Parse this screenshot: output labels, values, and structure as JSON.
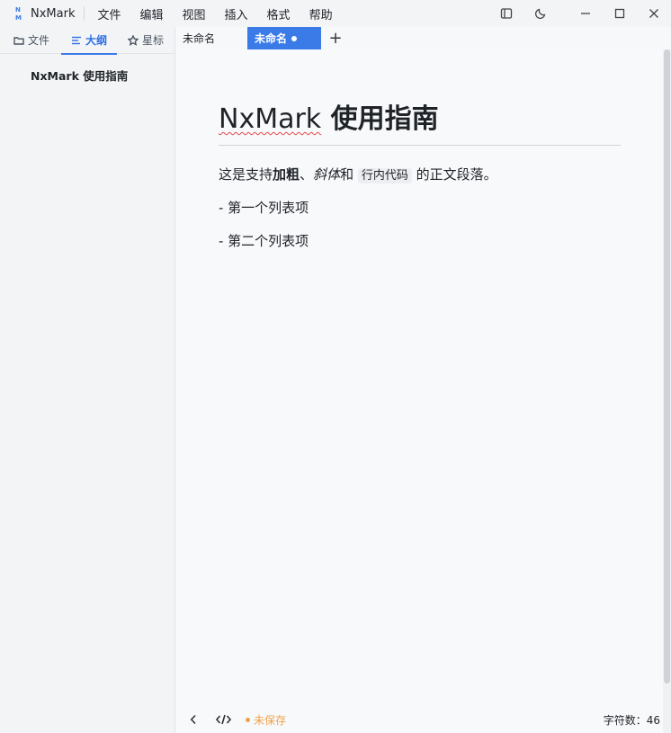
{
  "app": {
    "name": "NxMark",
    "accent": "#3b7be8",
    "unsaved_color": "#f0a24a"
  },
  "menu": [
    "文件",
    "编辑",
    "视图",
    "插入",
    "格式",
    "帮助"
  ],
  "window_controls": [
    "sidebar-toggle-icon",
    "moon-icon",
    "minimize-icon",
    "maximize-icon",
    "close-icon"
  ],
  "sidebar": {
    "tabs": [
      {
        "label": "文件",
        "icon": "folder-icon"
      },
      {
        "label": "大纲",
        "icon": "outline-icon",
        "active": true
      },
      {
        "label": "星标",
        "icon": "star-icon"
      }
    ],
    "outline": [
      "NxMark 使用指南"
    ]
  },
  "tabs": [
    {
      "label": "未命名",
      "active": false
    },
    {
      "label": "未命名",
      "active": true,
      "dirty": true
    }
  ],
  "add_tab": "+",
  "document": {
    "h1_spell": "NxMark",
    "h1_rest": " 使用指南",
    "p1": {
      "t1": "这是支持",
      "bold": "加粗",
      "t2": "、",
      "italic": "斜体",
      "t3": "和",
      "code": "行内代码",
      "t4": "的正文段落。"
    },
    "list1": "- 第一个列表项",
    "list2": "- 第二个列表项"
  },
  "status": {
    "unsaved": "未保存",
    "wordcount": "字符数：46"
  }
}
